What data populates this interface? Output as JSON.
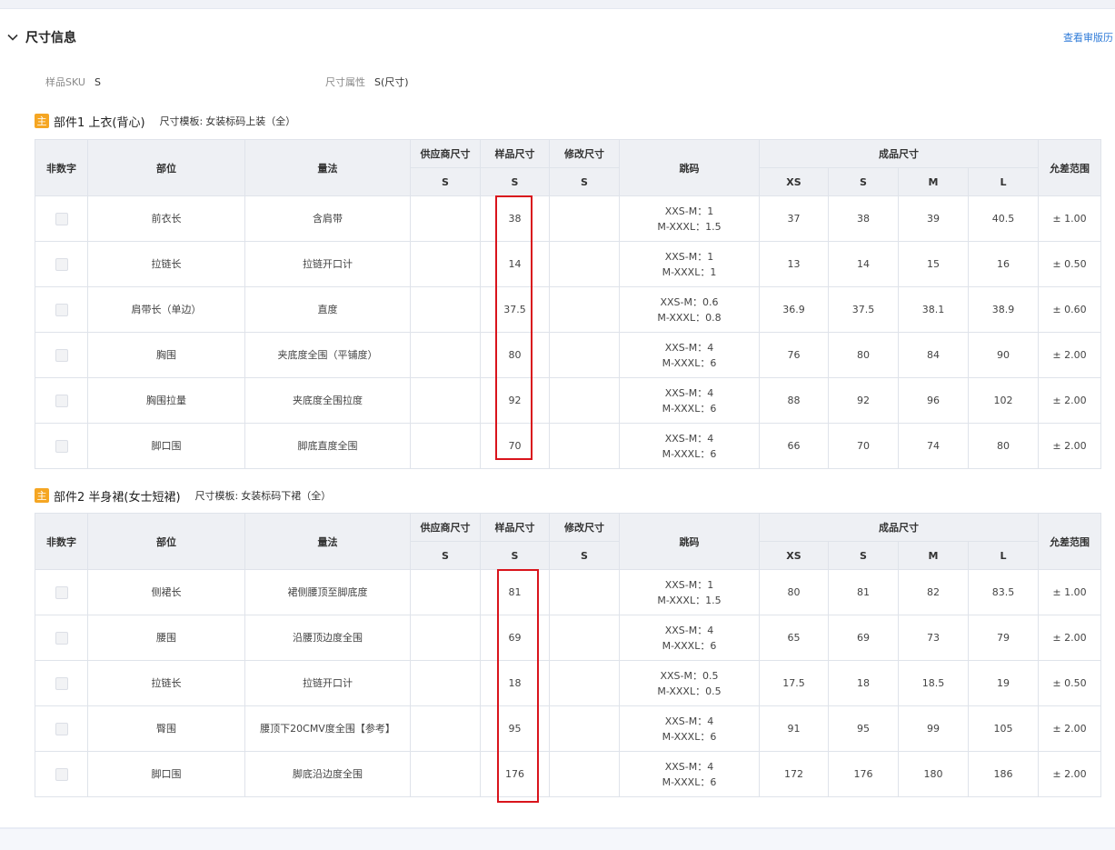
{
  "section": {
    "title": "尺寸信息",
    "history_link": "查看审版历"
  },
  "meta": {
    "sku_label": "样品SKU",
    "sku_value": "S",
    "attr_label": "尺寸属性",
    "attr_value": "S(尺寸)"
  },
  "headers": {
    "non_numeric": "非数字",
    "part": "部位",
    "method": "量法",
    "supplier": "供应商尺寸",
    "sample": "样品尺寸",
    "modify": "修改尺寸",
    "jump": "跳码",
    "finished": "成品尺寸",
    "tolerance": "允差范围",
    "sub_s": "S",
    "sizes": [
      "XS",
      "S",
      "M",
      "L"
    ]
  },
  "parts": [
    {
      "badge": "主",
      "name": "部件1 上衣(背心)",
      "template_label": "尺寸模板:",
      "template": "女装标码上装（全）",
      "rows": [
        {
          "part": "前衣长",
          "method": "含肩带",
          "supplier": "",
          "sample": "38",
          "modify": "",
          "jump1": "XXS-M：1",
          "jump2": "M-XXXL：1.5",
          "sizes": [
            "37",
            "38",
            "39",
            "40.5"
          ],
          "tol": "± 1.00"
        },
        {
          "part": "拉链长",
          "method": "拉链开口计",
          "supplier": "",
          "sample": "14",
          "modify": "",
          "jump1": "XXS-M：1",
          "jump2": "M-XXXL：1",
          "sizes": [
            "13",
            "14",
            "15",
            "16"
          ],
          "tol": "± 0.50"
        },
        {
          "part": "肩带长（单边）",
          "method": "直度",
          "supplier": "",
          "sample": "37.5",
          "modify": "",
          "jump1": "XXS-M：0.6",
          "jump2": "M-XXXL：0.8",
          "sizes": [
            "36.9",
            "37.5",
            "38.1",
            "38.9"
          ],
          "tol": "± 0.60"
        },
        {
          "part": "胸围",
          "method": "夹底度全围（平铺度）",
          "supplier": "",
          "sample": "80",
          "modify": "",
          "jump1": "XXS-M：4",
          "jump2": "M-XXXL：6",
          "sizes": [
            "76",
            "80",
            "84",
            "90"
          ],
          "tol": "± 2.00"
        },
        {
          "part": "胸围拉量",
          "method": "夹底度全围拉度",
          "supplier": "",
          "sample": "92",
          "modify": "",
          "jump1": "XXS-M：4",
          "jump2": "M-XXXL：6",
          "sizes": [
            "88",
            "92",
            "96",
            "102"
          ],
          "tol": "± 2.00"
        },
        {
          "part": "脚口围",
          "method": "脚底直度全围",
          "supplier": "",
          "sample": "70",
          "modify": "",
          "jump1": "XXS-M：4",
          "jump2": "M-XXXL：6",
          "sizes": [
            "66",
            "70",
            "74",
            "80"
          ],
          "tol": "± 2.00"
        }
      ]
    },
    {
      "badge": "主",
      "name": "部件2 半身裙(女士短裙)",
      "template_label": "尺寸模板:",
      "template": "女装标码下裙（全）",
      "rows": [
        {
          "part": "侧裙长",
          "method": "裙侧腰顶至脚底度",
          "supplier": "",
          "sample": "81",
          "modify": "",
          "jump1": "XXS-M：1",
          "jump2": "M-XXXL：1.5",
          "sizes": [
            "80",
            "81",
            "82",
            "83.5"
          ],
          "tol": "± 1.00"
        },
        {
          "part": "腰围",
          "method": "沿腰顶边度全围",
          "supplier": "",
          "sample": "69",
          "modify": "",
          "jump1": "XXS-M：4",
          "jump2": "M-XXXL：6",
          "sizes": [
            "65",
            "69",
            "73",
            "79"
          ],
          "tol": "± 2.00"
        },
        {
          "part": "拉链长",
          "method": "拉链开口计",
          "supplier": "",
          "sample": "18",
          "modify": "",
          "jump1": "XXS-M：0.5",
          "jump2": "M-XXXL：0.5",
          "sizes": [
            "17.5",
            "18",
            "18.5",
            "19"
          ],
          "tol": "± 0.50"
        },
        {
          "part": "臀围",
          "method": "腰顶下20CMV度全围【参考】",
          "supplier": "",
          "sample": "95",
          "modify": "",
          "jump1": "XXS-M：4",
          "jump2": "M-XXXL：6",
          "sizes": [
            "91",
            "95",
            "99",
            "105"
          ],
          "tol": "± 2.00"
        },
        {
          "part": "脚口围",
          "method": "脚底沿边度全围",
          "supplier": "",
          "sample": "176",
          "modify": "",
          "jump1": "XXS-M：4",
          "jump2": "M-XXXL：6",
          "sizes": [
            "172",
            "176",
            "180",
            "186"
          ],
          "tol": "± 2.00"
        }
      ]
    }
  ]
}
